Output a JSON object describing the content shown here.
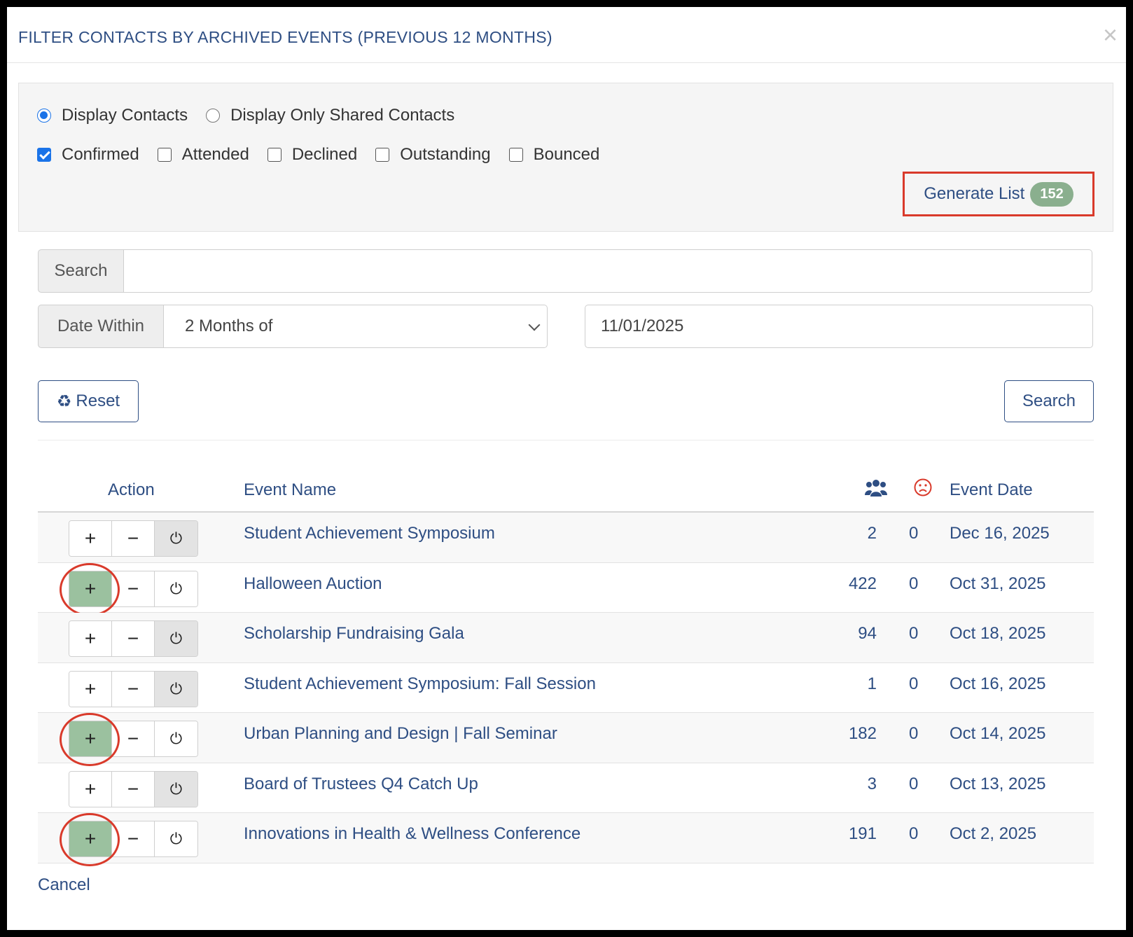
{
  "modal": {
    "title": "FILTER CONTACTS BY ARCHIVED EVENTS (PREVIOUS 12 MONTHS)",
    "close_glyph": "×"
  },
  "display_options": [
    {
      "label": "Display Contacts",
      "checked": true
    },
    {
      "label": "Display Only Shared Contacts",
      "checked": false
    }
  ],
  "status_options": [
    {
      "label": "Confirmed",
      "checked": true
    },
    {
      "label": "Attended",
      "checked": false
    },
    {
      "label": "Declined",
      "checked": false
    },
    {
      "label": "Outstanding",
      "checked": false
    },
    {
      "label": "Bounced",
      "checked": false
    }
  ],
  "generate": {
    "label": "Generate List",
    "count": "152"
  },
  "search": {
    "addon": "Search",
    "value": ""
  },
  "date_filter": {
    "addon": "Date Within",
    "selected": "2 Months of",
    "date": "11/01/2025"
  },
  "buttons": {
    "reset": "Reset",
    "search": "Search",
    "cancel": "Cancel"
  },
  "icons": {
    "reset": "recycle-icon",
    "attendees": "people-icon",
    "declined": "sad-face-icon",
    "plus": "plus-icon",
    "minus": "minus-icon",
    "power": "power-icon"
  },
  "table": {
    "headers": {
      "action": "Action",
      "name": "Event Name",
      "date": "Event Date"
    },
    "rows": [
      {
        "name": "Student Achievement Symposium",
        "attendees": "2",
        "declined": "0",
        "date": "Dec 16, 2025",
        "state": "off"
      },
      {
        "name": "Halloween Auction",
        "attendees": "422",
        "declined": "0",
        "date": "Oct 31, 2025",
        "state": "include"
      },
      {
        "name": "Scholarship Fundraising Gala",
        "attendees": "94",
        "declined": "0",
        "date": "Oct 18, 2025",
        "state": "off"
      },
      {
        "name": "Student Achievement Symposium: Fall Session",
        "attendees": "1",
        "declined": "0",
        "date": "Oct 16, 2025",
        "state": "off"
      },
      {
        "name": "Urban Planning and Design | Fall Seminar",
        "attendees": "182",
        "declined": "0",
        "date": "Oct 14, 2025",
        "state": "include"
      },
      {
        "name": "Board of Trustees Q4 Catch Up",
        "attendees": "3",
        "declined": "0",
        "date": "Oct 13, 2025",
        "state": "off"
      },
      {
        "name": "Innovations in Health & Wellness Conference",
        "attendees": "191",
        "declined": "0",
        "date": "Oct 2, 2025",
        "state": "include"
      }
    ]
  },
  "colors": {
    "primary": "#2e4e83",
    "highlight": "#d93a2b",
    "include_green": "#9bc19f",
    "badge_green": "#8aaf8e",
    "checkbox_blue": "#1a73e8"
  }
}
